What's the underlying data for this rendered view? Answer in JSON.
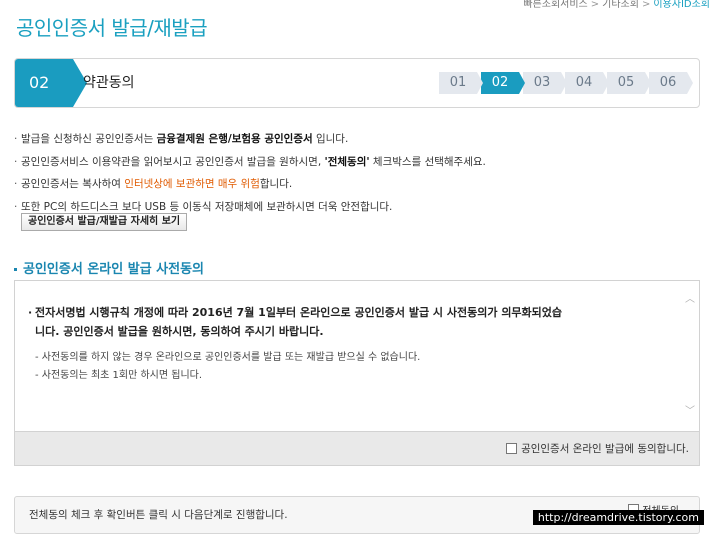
{
  "breadcrumb": {
    "items": [
      "빠른조회서비스",
      "기타조회",
      "이용자ID조회"
    ],
    "separator": ">"
  },
  "page": {
    "title": "공인인증서 발급/재발급"
  },
  "steps": {
    "current_number": "02",
    "current_label": "약관동의",
    "list": [
      "01",
      "02",
      "03",
      "04",
      "05",
      "06"
    ],
    "active_index": 1
  },
  "notices": {
    "n1_pre": "발급을 신청하신 공인인증서는 ",
    "n1_bold": "금융결제원 은행/보험용 공인인증서",
    "n1_post": " 입니다.",
    "n2_pre": "공인인증서비스 이용약관을 읽어보시고 공인인증서 발급을 원하시면, ",
    "n2_bold": "'전체동의'",
    "n2_post": " 체크박스를 선택해주세요.",
    "n3_pre": "공인인증서는 복사하여 ",
    "n3_warn": "인터넷상에 보관하면 매우 위험",
    "n3_post": "합니다.",
    "n4": "또한 PC의 하드디스크 보다 USB 등 이동식 저장매체에 보관하시면 더욱 안전합니다.",
    "detail_button": "공인인증서 발급/재발급 자세히 보기"
  },
  "consent": {
    "section_title": "공인인증서 온라인 발급 사전동의",
    "lead_line1": "전자서명법 시행규칙 개정에 따라 2016년 7월 1일부터 온라인으로 공인인증서 발급 시 사전동의가 의무화되었습",
    "lead_line2": "니다. 공인인증서 발급을 원하시면, 동의하여 주시기 바랍니다.",
    "sub1": "- 사전동의를 하지 않는 경우 온라인으로 공인인증서를 발급 또는 재발급 받으실 수 없습니다.",
    "sub2": "- 사전동의는 최초 1회만 하시면 됩니다.",
    "agree_label": "공인인증서 온라인 발급에 동의합니다.",
    "agree_checked": false
  },
  "footer": {
    "instruction": "전체동의 체크 후 확인버튼 클릭 시 다음단계로 진행합니다.",
    "all_agree_label": "전체동의",
    "watermark": "http://dreamdrive.tistory.com"
  },
  "colors": {
    "accent": "#1a9cc0",
    "warning": "#e05a00",
    "step_inactive": "#e4e8ee"
  }
}
